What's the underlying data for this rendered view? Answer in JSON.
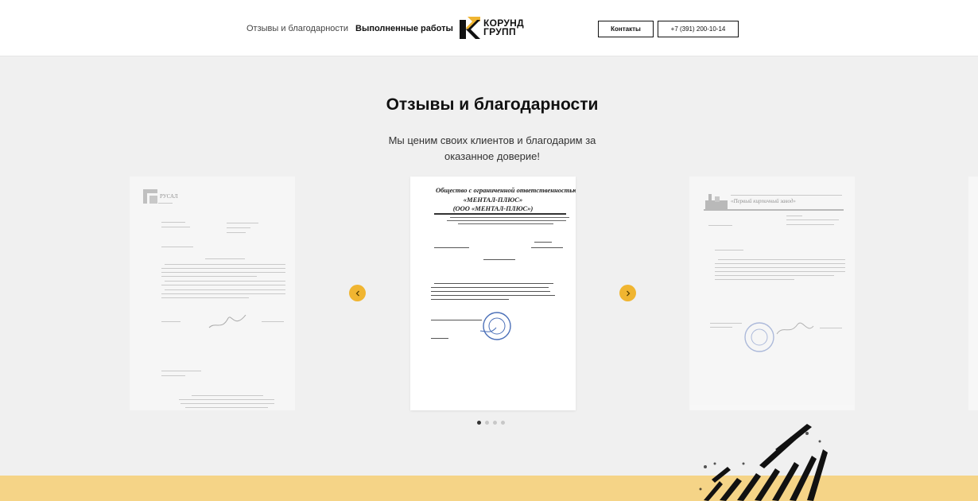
{
  "header": {
    "nav": [
      {
        "label": "Отзывы и благодарности"
      },
      {
        "label": "Выполненные работы"
      }
    ],
    "logo": {
      "line1": "КОРУНД",
      "line2": "ГРУПП"
    },
    "contacts_label": "Контакты",
    "phone_label": "+7 (391) 200-10-14"
  },
  "section": {
    "title": "Отзывы и благодарности",
    "subtitle": "Мы ценим своих клиентов и благодарим за оказанное доверие!"
  },
  "slider": {
    "slides": [
      {
        "org": "РУСАЛ"
      },
      {
        "org_line1": "Общество с ограниченной ответственностью",
        "org_line2": "«МЕНТАЛ-ПЛЮС»",
        "org_line3": "(ООО «МЕНТАЛ-ПЛЮС»)"
      },
      {
        "org": "«Первый кирпичный завод»"
      }
    ],
    "dots_total": 4,
    "active_dot": 1
  },
  "colors": {
    "accent": "#f0b531",
    "band": "#f5d487",
    "background": "#f0f0f0"
  },
  "icons": {
    "prev": "chevron-left-icon",
    "next": "chevron-right-icon"
  }
}
